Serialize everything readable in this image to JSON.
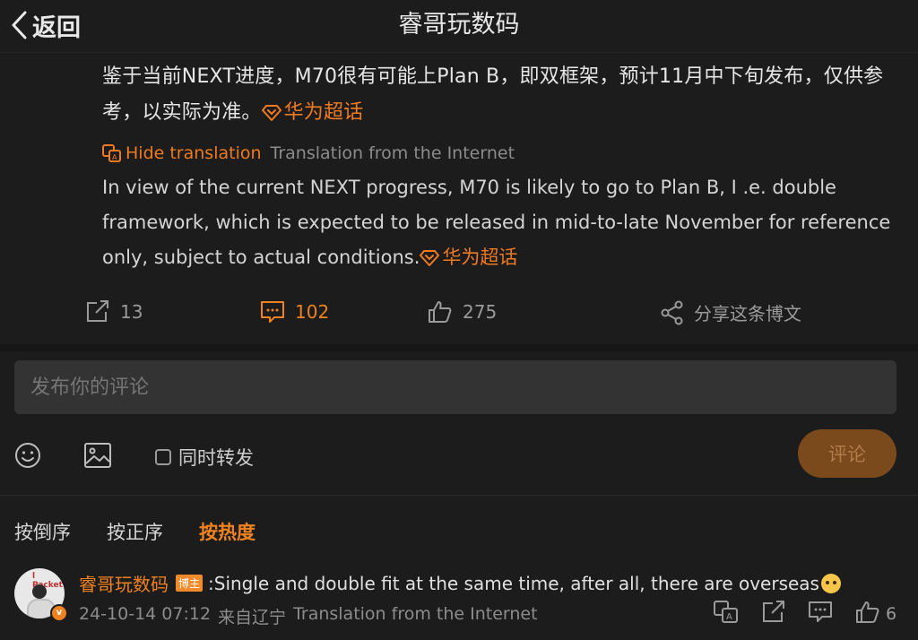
{
  "header": {
    "back_label": "返回",
    "title": "睿哥玩数码"
  },
  "post": {
    "original_text": "鉴于当前NEXT进度，M70很有可能上Plan B，即双框架，预计11月中下旬发布，仅供参考，以实际为准。",
    "topic": "华为超话",
    "hide_translation_label": "Hide translation",
    "translation_source": "Translation from the Internet",
    "translated_text": "In view of the current NEXT progress, M70 is likely to go to Plan B, I .e. double framework, which is expected to be released in mid-to-late November for reference only, subject to actual conditions.",
    "accent_color": "#f07a1f"
  },
  "actions": {
    "repost_count": "13",
    "comment_count": "102",
    "like_count": "275",
    "share_label": "分享这条博文"
  },
  "composer": {
    "placeholder": "发布你的评论",
    "repost_label": "同时转发",
    "submit_label": "评论",
    "emoji_icon": "smiley-icon",
    "image_icon": "image-icon"
  },
  "sort": {
    "reverse": "按倒序",
    "forward": "按正序",
    "hot": "按热度",
    "active": "hot"
  },
  "comments": [
    {
      "author": "睿哥玩数码",
      "badge": "博主",
      "text": ":Single and double fit at the same time, after all, there are overseas",
      "timestamp": "24-10-14 07:12",
      "location": "来自辽宁",
      "translation_source": "Translation from the Internet",
      "like_count": "6",
      "avatar_text": "l Packet"
    }
  ]
}
